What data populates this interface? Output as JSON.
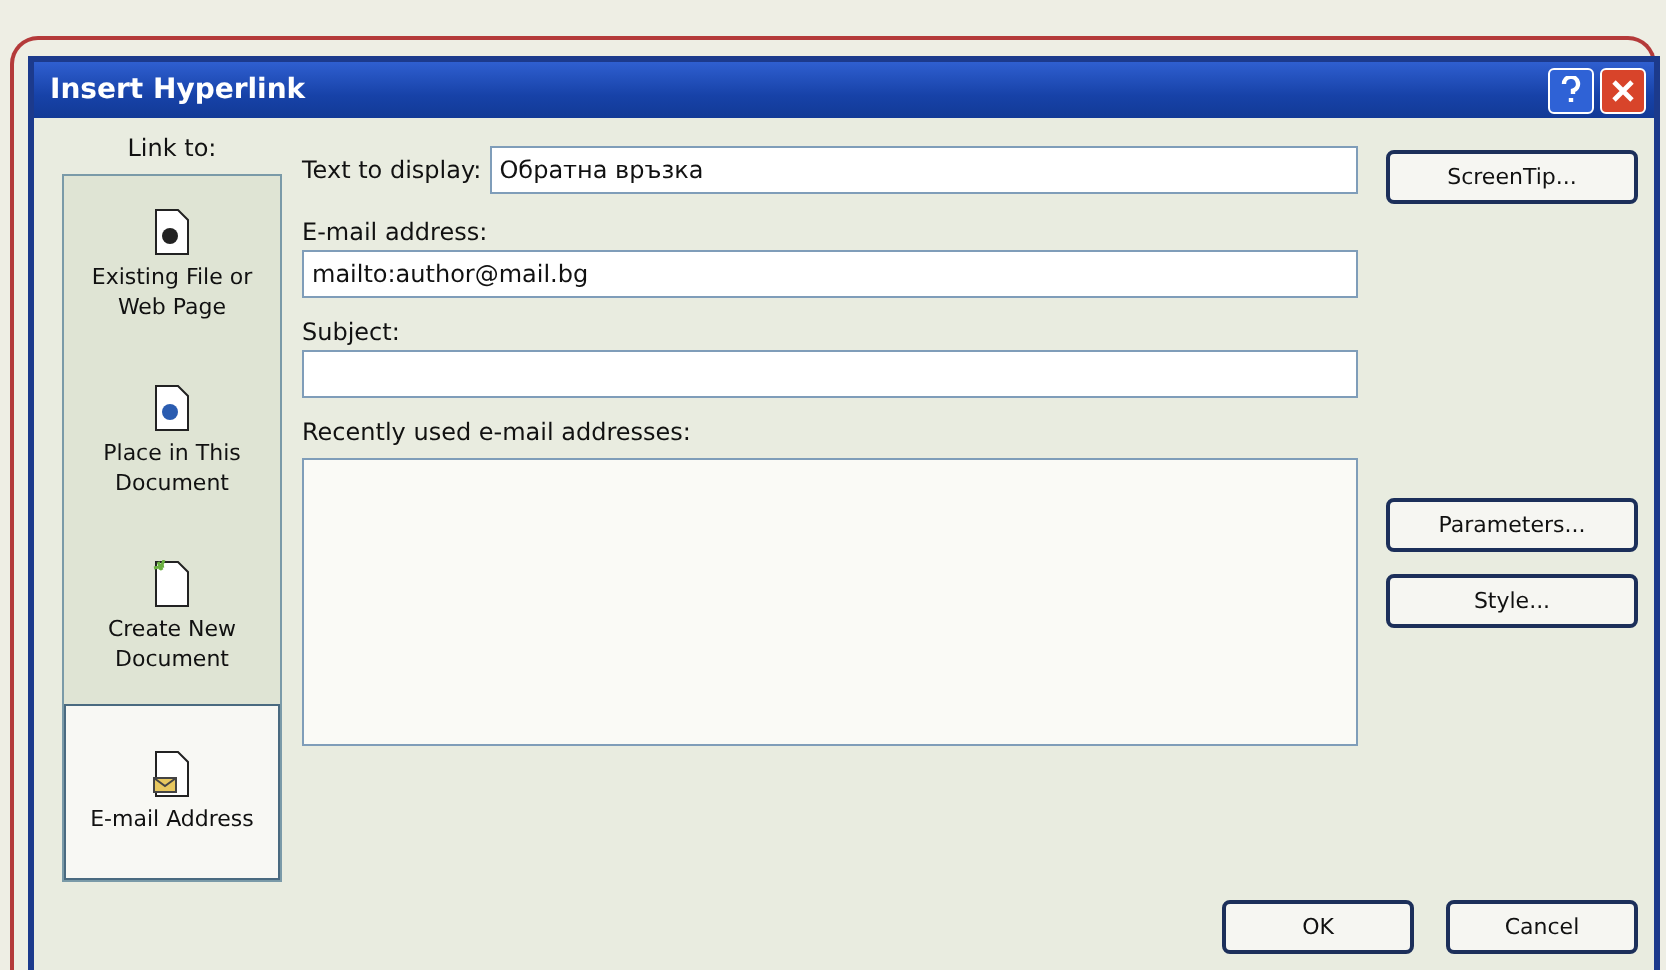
{
  "window": {
    "title": "Insert Hyperlink"
  },
  "link_to": {
    "label": "Link to:",
    "items": [
      {
        "label": "Existing File or Web Page",
        "kind": "file",
        "selected": false
      },
      {
        "label": "Place in This Document",
        "kind": "place",
        "selected": false
      },
      {
        "label": "Create New Document",
        "kind": "new",
        "selected": false
      },
      {
        "label": "E-mail Address",
        "kind": "email",
        "selected": true
      }
    ]
  },
  "text_to_display": {
    "label": "Text to display:",
    "value": "Обратна връзка"
  },
  "email_address": {
    "label": "E-mail address:",
    "value": "mailto:author@mail.bg"
  },
  "subject": {
    "label": "Subject:"
  },
  "recent": {
    "label": "Recently used e-mail addresses:"
  },
  "side_buttons": [
    "ScreenTip...",
    "Parameters...",
    "Style..."
  ],
  "buttons": [
    "OK",
    "Cancel"
  ]
}
